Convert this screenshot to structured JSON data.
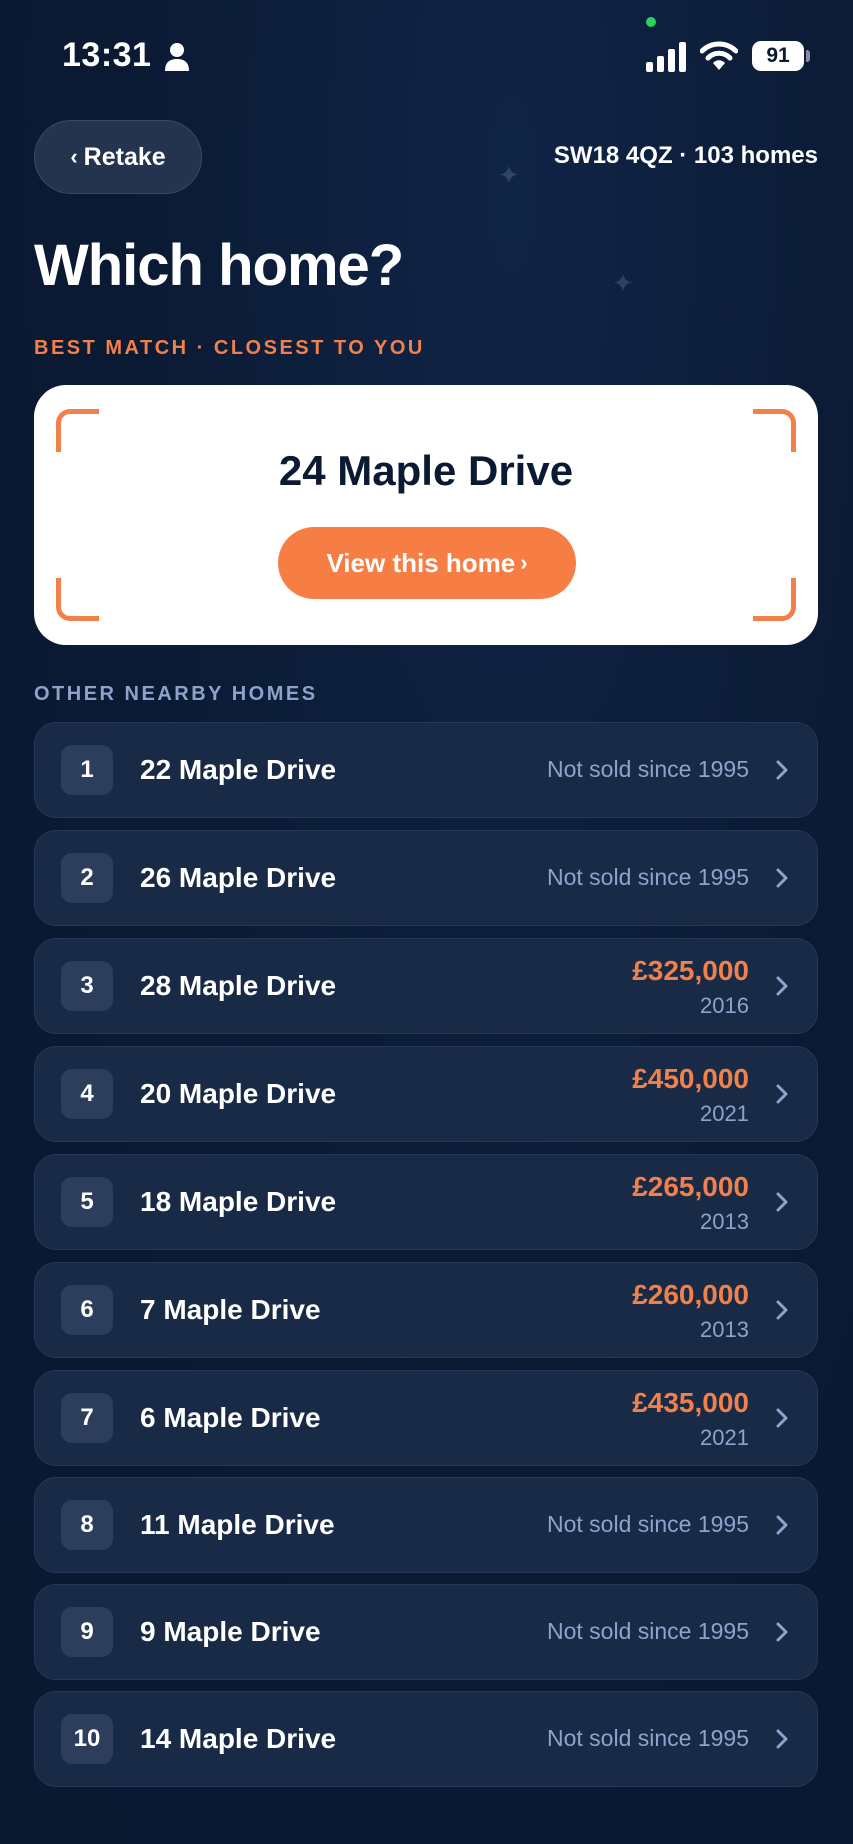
{
  "status_bar": {
    "time": "13:31",
    "battery": "91"
  },
  "header": {
    "retake_label": "Retake",
    "postcode_info": "SW18 4QZ · 103 homes",
    "title": "Which home?"
  },
  "best_match": {
    "section_label": "BEST MATCH · CLOSEST TO YOU",
    "address": "24 Maple Drive",
    "button_label": "View this home"
  },
  "other_homes": {
    "section_label": "OTHER NEARBY HOMES",
    "items": [
      {
        "rank": "1",
        "address": "22 Maple Drive",
        "status": "Not sold since 1995"
      },
      {
        "rank": "2",
        "address": "26 Maple Drive",
        "status": "Not sold since 1995"
      },
      {
        "rank": "3",
        "address": "28 Maple Drive",
        "price": "£325,000",
        "year": "2016"
      },
      {
        "rank": "4",
        "address": "20 Maple Drive",
        "price": "£450,000",
        "year": "2021"
      },
      {
        "rank": "5",
        "address": "18 Maple Drive",
        "price": "£265,000",
        "year": "2013"
      },
      {
        "rank": "6",
        "address": "7 Maple Drive",
        "price": "£260,000",
        "year": "2013"
      },
      {
        "rank": "7",
        "address": "6 Maple Drive",
        "price": "£435,000",
        "year": "2021"
      },
      {
        "rank": "8",
        "address": "11 Maple Drive",
        "status": "Not sold since 1995"
      },
      {
        "rank": "9",
        "address": "9 Maple Drive",
        "status": "Not sold since 1995"
      },
      {
        "rank": "10",
        "address": "14 Maple Drive",
        "status": "Not sold since 1995"
      }
    ]
  },
  "colors": {
    "background": "#0b1a33",
    "accent": "#f67e45",
    "price": "#f2804a",
    "muted": "#8ca3cc",
    "row": "#182a46"
  },
  "icons": {
    "person": "person-icon",
    "signal": "signal-icon",
    "wifi": "wifi-icon",
    "battery": "battery-icon",
    "back": "chevron-left-icon",
    "forward": "chevron-right-icon"
  }
}
